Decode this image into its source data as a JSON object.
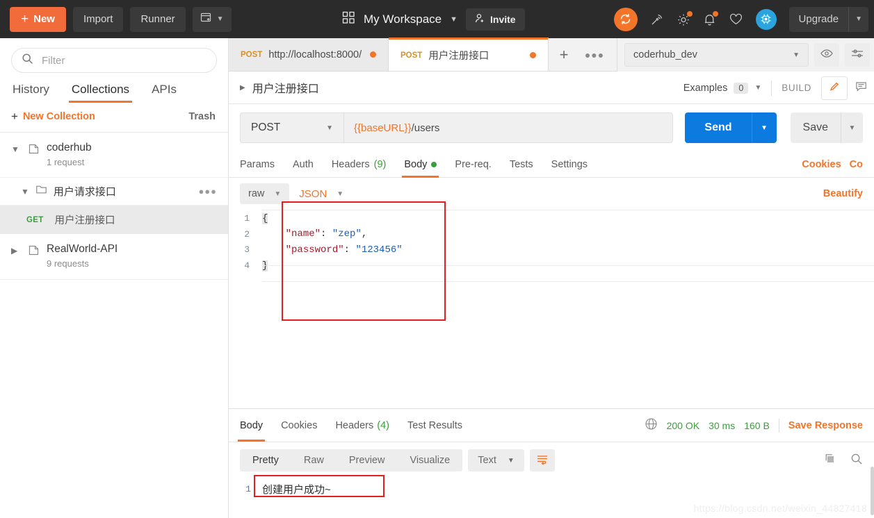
{
  "header": {
    "new_button": "New",
    "new_icon": "plus-icon",
    "import_button": "Import",
    "runner_button": "Runner",
    "new_window_icon": "new-window-icon",
    "workspace_icon": "grid-icon",
    "workspace_title": "My Workspace",
    "workspace_caret": "chevron-down-icon",
    "invite_label": "Invite",
    "invite_icon": "person-add-icon",
    "sync_icon": "sync-icon",
    "satellite_icon": "satellite-icon",
    "settings_icon": "gear-icon",
    "notifications_icon": "bell-icon",
    "heart_icon": "heart-icon",
    "avatar_icon": "chip-avatar-icon",
    "upgrade_label": "Upgrade",
    "accent_orange": "#f2752a",
    "bg_dark": "#2b2b2b"
  },
  "sidebar": {
    "filter_placeholder": "Filter",
    "filter_value": "",
    "search_icon": "search-icon",
    "tabs": [
      {
        "label": "History",
        "active": false
      },
      {
        "label": "Collections",
        "active": true
      },
      {
        "label": "APIs",
        "active": false
      }
    ],
    "new_collection": "New Collection",
    "trash": "Trash",
    "collections": [
      {
        "name": "coderhub",
        "sub": "1 request",
        "expanded": true,
        "chevron": "chevron-down-icon",
        "icon": "collection-icon"
      },
      {
        "name": "RealWorld-API",
        "sub": "9 requests",
        "expanded": false,
        "chevron": "chevron-right-icon",
        "icon": "collection-icon"
      }
    ],
    "folder": {
      "name": "用户请求接口",
      "chevron": "chevron-down-icon",
      "icon": "folder-icon",
      "more": "more-options-icon"
    },
    "request": {
      "method": "GET",
      "name": "用户注册接口",
      "method_color": "#3a9e3a"
    }
  },
  "tabstrip": {
    "tabs": [
      {
        "method": "POST",
        "title": "http://localhost:8000/",
        "active": false,
        "unsaved": true
      },
      {
        "method": "POST",
        "title": "用户注册接口",
        "active": true,
        "unsaved": true
      }
    ],
    "add_tab_icon": "plus-icon",
    "tab_options_icon": "more-options-icon",
    "environment": "coderhub_dev",
    "environment_caret": "chevron-down-icon",
    "eye_icon": "eye-icon",
    "env_settings_icon": "sliders-icon"
  },
  "request": {
    "title": "用户注册接口",
    "title_caret": "triangle-right-icon",
    "examples_label": "Examples",
    "examples_count": "0",
    "examples_caret": "chevron-down-icon",
    "build_label": "BUILD",
    "edit_icon": "pencil-icon",
    "comment_icon": "comment-icon",
    "method": "POST",
    "method_caret": "chevron-down-icon",
    "url_variable": "{{baseURL}}",
    "url_path": "/users",
    "send_label": "Send",
    "send_caret": "chevron-down-icon",
    "save_label": "Save",
    "save_caret": "chevron-down-icon",
    "tabs": [
      {
        "label": "Params",
        "active": false
      },
      {
        "label": "Auth",
        "active": false
      },
      {
        "label": "Headers",
        "count": "(9)",
        "active": false
      },
      {
        "label": "Body",
        "active": true,
        "dot": true
      },
      {
        "label": "Pre-req.",
        "active": false
      },
      {
        "label": "Tests",
        "active": false
      },
      {
        "label": "Settings",
        "active": false
      }
    ],
    "cookies_link": "Cookies",
    "code_link": "Co",
    "body_type": "raw",
    "body_type_caret": "chevron-down-icon",
    "body_format": "JSON",
    "body_format_caret": "chevron-down-icon",
    "beautify_label": "Beautify",
    "code_lines": [
      {
        "num": "1",
        "segments": [
          {
            "t": "{",
            "c": "brace"
          }
        ]
      },
      {
        "num": "2",
        "segments": [
          {
            "t": "    ",
            "c": "p"
          },
          {
            "t": "\"name\"",
            "c": "k"
          },
          {
            "t": ": ",
            "c": "p"
          },
          {
            "t": "\"zep\"",
            "c": "v"
          },
          {
            "t": ",",
            "c": "p"
          }
        ]
      },
      {
        "num": "3",
        "segments": [
          {
            "t": "    ",
            "c": "p"
          },
          {
            "t": "\"password\"",
            "c": "k"
          },
          {
            "t": ": ",
            "c": "p"
          },
          {
            "t": "\"123456\"",
            "c": "v"
          }
        ]
      },
      {
        "num": "4",
        "segments": [
          {
            "t": "}",
            "c": "brace"
          }
        ]
      }
    ]
  },
  "response": {
    "tabs": [
      {
        "label": "Body",
        "active": true
      },
      {
        "label": "Cookies",
        "active": false
      },
      {
        "label": "Headers",
        "count": "(4)",
        "active": false
      },
      {
        "label": "Test Results",
        "active": false
      }
    ],
    "globe_icon": "globe-icon",
    "status": "200 OK",
    "time": "30 ms",
    "size": "160 B",
    "save_response": "Save Response",
    "view_modes": [
      {
        "label": "Pretty",
        "active": true
      },
      {
        "label": "Raw",
        "active": false
      },
      {
        "label": "Preview",
        "active": false
      },
      {
        "label": "Visualize",
        "active": false
      }
    ],
    "format": "Text",
    "format_caret": "chevron-down-icon",
    "wrap_icon": "word-wrap-icon",
    "copy_icon": "copy-icon",
    "search_icon": "search-icon",
    "body_lines": [
      {
        "num": "1",
        "text": "创建用户成功~"
      }
    ]
  },
  "annotations": {
    "watermark": "https://blog.csdn.net/weixin_44827418",
    "highlight_color": "#e02020"
  }
}
